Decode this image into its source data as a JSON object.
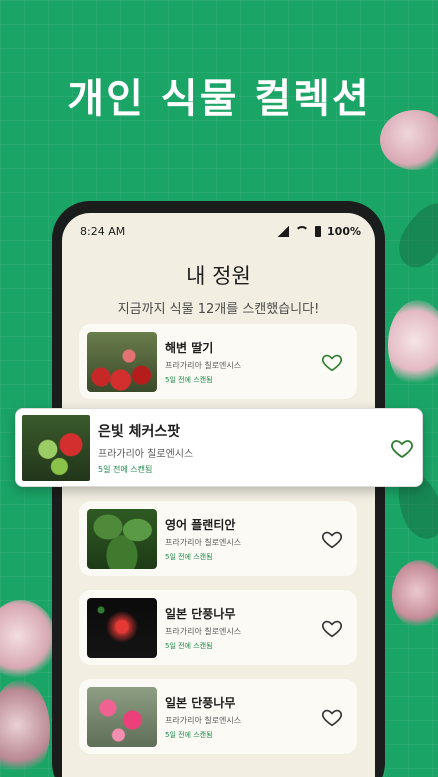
{
  "headline": "개인 식물 컬렉션",
  "status": {
    "time": "8:24 AM",
    "battery": "100%"
  },
  "garden": {
    "title": "내 정원",
    "subtitle": "지금까지 식물 12개를 스캔했습니다!"
  },
  "plants": [
    {
      "name": "해변 딸기",
      "scientific": "프라가리아 칠로엔시스",
      "scanned": "5일 전에 스캔됨",
      "favorite_icon": "heart-outline-icon",
      "favorite_color": "#2e7d32"
    },
    {
      "name": "은빛 체커스팟",
      "scientific": "프라가리아 칠로엔시스",
      "scanned": "5일 전에 스캔됨",
      "favorite_icon": "heart-outline-icon",
      "favorite_color": "#2e7d32"
    },
    {
      "name": "영어 플랜티안",
      "scientific": "프라가리아 칠로엔시스",
      "scanned": "5일 전에 스캔됨",
      "favorite_icon": "heart-outline-icon",
      "favorite_color": "#333333"
    },
    {
      "name": "일본 단풍나무",
      "scientific": "프라가리아 칠로엔시스",
      "scanned": "5일 전에 스캔됨",
      "favorite_icon": "heart-outline-icon",
      "favorite_color": "#333333"
    },
    {
      "name": "일본 단풍나무",
      "scientific": "프라가리아 칠로엔시스",
      "scanned": "5일 전에 스캔됨",
      "favorite_icon": "heart-outline-icon",
      "favorite_color": "#333333"
    }
  ],
  "colors": {
    "brand_green": "#1aa567",
    "accent_green": "#1c8a4b",
    "screen_bg": "#f2efe2"
  }
}
